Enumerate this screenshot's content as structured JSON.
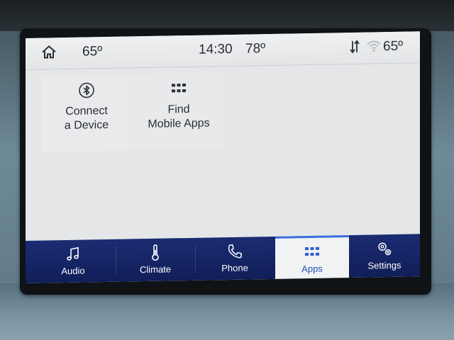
{
  "status_bar": {
    "home_icon": "home-icon",
    "home_temp": "65º",
    "clock": "14:30",
    "outside_temp": "78º",
    "signal_icon": "signal-arrows-icon",
    "wifi_icon": "wifi-icon",
    "right_temp": "65º"
  },
  "tiles": [
    {
      "icon": "bluetooth-icon",
      "label": "Connect\na Device"
    },
    {
      "icon": "grid-icon",
      "label": "Find\nMobile Apps"
    }
  ],
  "nav": {
    "items": [
      {
        "icon": "music-note-icon",
        "label": "Audio"
      },
      {
        "icon": "thermometer-icon",
        "label": "Climate"
      },
      {
        "icon": "phone-icon",
        "label": "Phone"
      },
      {
        "icon": "apps-grid-icon",
        "label": "Apps",
        "active": true
      },
      {
        "icon": "gears-icon",
        "label": "Settings"
      }
    ]
  },
  "colors": {
    "nav_background": "#14246a",
    "active_tab_text": "#1f4fb5",
    "screen_background": "#e4e6e8"
  }
}
